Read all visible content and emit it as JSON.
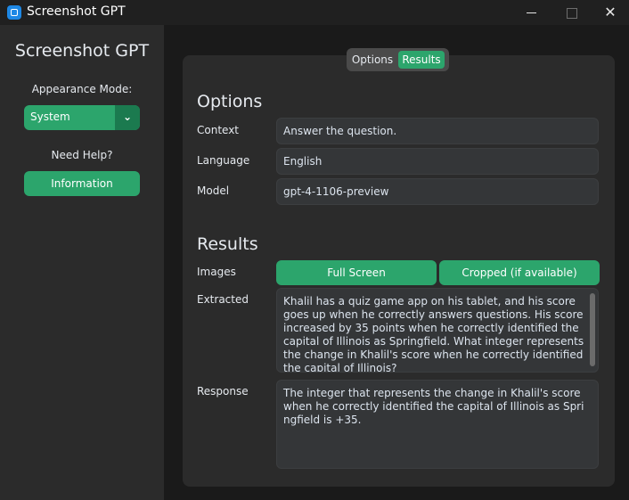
{
  "window": {
    "title": "Screenshot GPT"
  },
  "sidebar": {
    "app_name": "Screenshot GPT",
    "appearance_label": "Appearance Mode:",
    "appearance_value": "System",
    "help_label": "Need Help?",
    "info_button": "Information"
  },
  "tabs": {
    "options": "Options",
    "results": "Results",
    "active": "Results"
  },
  "options": {
    "title": "Options",
    "context_label": "Context",
    "context_value": "Answer the question.",
    "language_label": "Language",
    "language_value": "English",
    "model_label": "Model",
    "model_value": "gpt-4-1106-preview"
  },
  "results": {
    "title": "Results",
    "images_label": "Images",
    "full_screen": "Full Screen",
    "cropped": "Cropped (if available)",
    "extracted_label": "Extracted",
    "extracted_text": "Khalil has a quiz game app on his tablet, and his score goes up when he correctly answers questions. His score increased by 35 points when he correctly identified the capital of Illinois as Springfield. What integer represents the change in Khalil's score when he correctly identified the capital of Illinois?",
    "response_label": "Response",
    "response_text": "The integer that represents the change in Khalil's score when he correctly identified the capital of Illinois as Springfield is +35."
  },
  "colors": {
    "accent": "#2ca56c",
    "accent_dark": "#1b7a4f",
    "panel": "#2b2b2b",
    "background": "#1a1a1a"
  }
}
